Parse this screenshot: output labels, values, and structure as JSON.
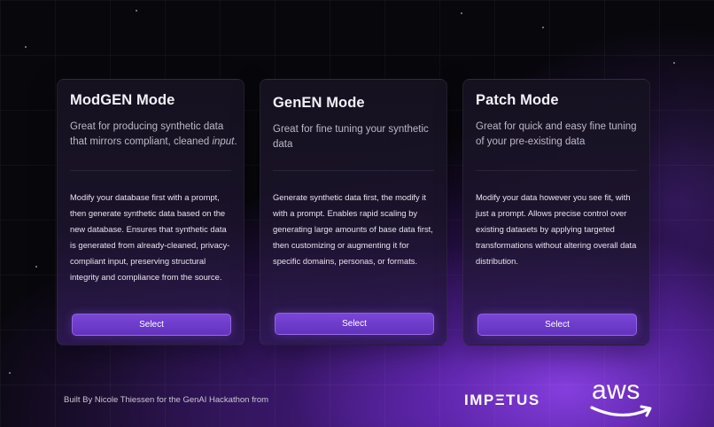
{
  "colors": {
    "accent": "#6f3fd0",
    "background": "#08070c",
    "glow": "#8a40e6"
  },
  "cards": [
    {
      "title": "ModGEN Mode",
      "subtitle": "Great for producing synthetic data that mirrors compliant, cleaned",
      "subtitle_emphasis": "input",
      "subtitle_end": ".",
      "description": "Modify your database first with a prompt, then generate synthetic data based on the new database. Ensures that synthetic data is generated from already-cleaned, privacy-compliant input, preserving structural integrity and compliance from the source.",
      "button_label": "Select"
    },
    {
      "title": "GenEN Mode",
      "subtitle": "Great for fine tuning your synthetic data",
      "description": "Generate synthetic data first, the modify it with a prompt. Enables rapid scaling by generating large amounts of base data first, then customizing or augmenting it for specific domains, personas, or formats.",
      "button_label": "Select"
    },
    {
      "title": "Patch Mode",
      "subtitle": "Great for quick and easy fine tuning of your pre-existing data",
      "description": "Modify your data however you see fit, with just a prompt. Allows precise control over existing datasets by applying targeted transformations without altering overall data distribution.",
      "button_label": "Select"
    }
  ],
  "footer": {
    "credit": "Built By Nicole Thiessen for the GenAI Hackathon from",
    "impetus_logo": "IMPΞTUS",
    "aws_logo": "aws"
  }
}
